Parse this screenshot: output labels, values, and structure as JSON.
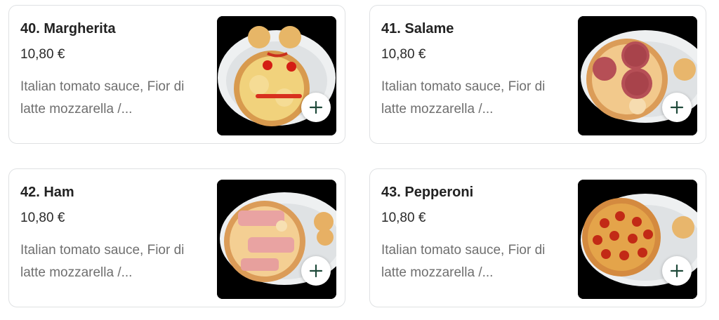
{
  "colors": {
    "title": "#222222",
    "description": "#6f6f6f",
    "plus": "#1f4a3a"
  },
  "products": [
    {
      "title": "40. Margherita",
      "price": "10,80 €",
      "description": "Italian tomato sauce, Fior di latte mozzarella /...",
      "image_icon": "margherita-pizza-photo",
      "add_icon": "plus-icon"
    },
    {
      "title": "41. Salame",
      "price": "10,80 €",
      "description": "Italian tomato sauce, Fior di latte mozzarella /...",
      "image_icon": "salame-pizza-photo",
      "add_icon": "plus-icon"
    },
    {
      "title": "42. Ham",
      "price": "10,80 €",
      "description": "Italian tomato sauce, Fior di latte mozzarella /...",
      "image_icon": "ham-pizza-photo",
      "add_icon": "plus-icon"
    },
    {
      "title": "43. Pepperoni",
      "price": "10,80 €",
      "description": "Italian tomato sauce, Fior di latte mozzarella /...",
      "image_icon": "pepperoni-pizza-photo",
      "add_icon": "plus-icon"
    }
  ]
}
